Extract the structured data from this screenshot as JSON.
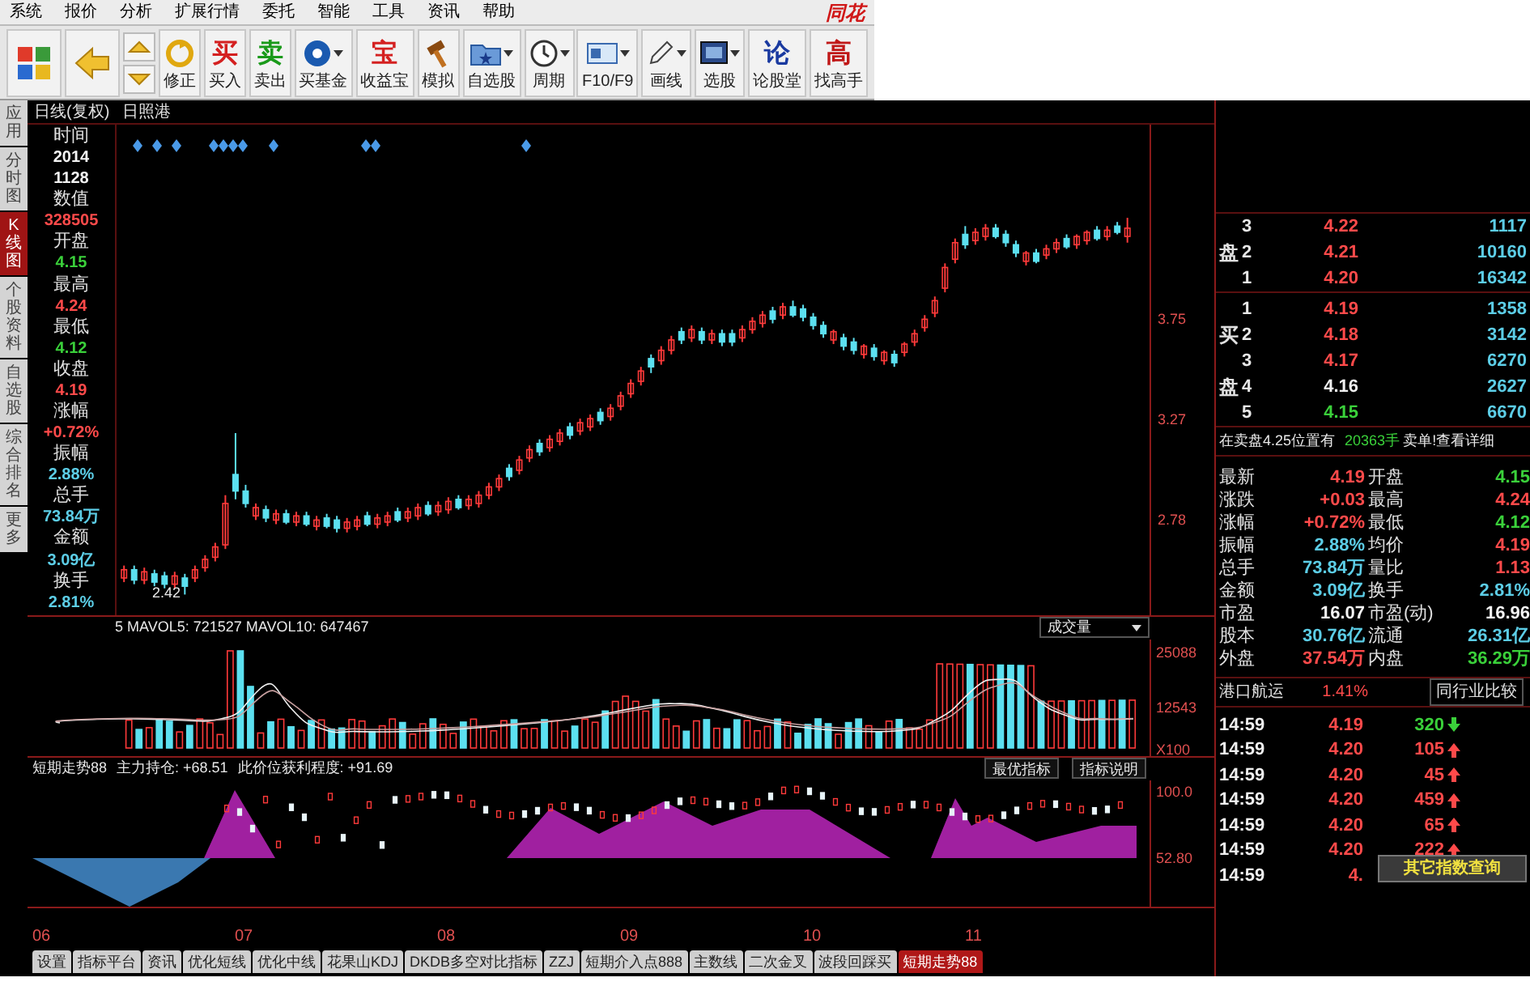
{
  "menu": [
    "系统",
    "报价",
    "分析",
    "扩展行情",
    "委托",
    "智能",
    "工具",
    "资讯",
    "帮助"
  ],
  "logo": "同花",
  "toolbar": [
    {
      "kind": "grid"
    },
    {
      "kind": "back"
    },
    {
      "kind": "updown"
    },
    {
      "kind": "refresh",
      "label": "修正"
    },
    {
      "kind": "glyph",
      "glyph": "买",
      "label": "买入",
      "color": "#d42020"
    },
    {
      "kind": "glyph",
      "glyph": "卖",
      "label": "卖出",
      "color": "#1a9a1a"
    },
    {
      "kind": "disc",
      "label": "买基金",
      "dropdown": true
    },
    {
      "kind": "glyph",
      "glyph": "宝",
      "label": "收益宝",
      "color": "#d42020"
    },
    {
      "kind": "hammer",
      "label": "模拟"
    },
    {
      "kind": "folder",
      "label": "自选股",
      "dropdown": true
    },
    {
      "kind": "clock",
      "label": "周期",
      "dropdown": true
    },
    {
      "kind": "card",
      "label": "F10/F9",
      "dropdown": true
    },
    {
      "kind": "pencil",
      "label": "画线",
      "dropdown": true
    },
    {
      "kind": "screen",
      "label": "选股",
      "dropdown": true
    },
    {
      "kind": "glyph",
      "glyph": "论",
      "label": "论股堂",
      "color": "#1a3aa0"
    },
    {
      "kind": "glyph",
      "glyph": "高",
      "label": "找高手",
      "color": "#c01818"
    }
  ],
  "side_tabs": [
    {
      "label": "应用",
      "selected": false
    },
    {
      "label": "分时图",
      "selected": false
    },
    {
      "label": "K线图",
      "selected": true
    },
    {
      "label": "个股资料",
      "selected": false
    },
    {
      "label": "自选股",
      "selected": false
    },
    {
      "label": "综合排名",
      "selected": false
    },
    {
      "label": "更多",
      "selected": false
    }
  ],
  "chart_title": {
    "period": "日线(复权)",
    "stock": "日照港"
  },
  "info_panel": [
    {
      "text": "时间",
      "kind": "label"
    },
    {
      "text": "2014",
      "kind": "value",
      "color": "#f4f4f4"
    },
    {
      "text": "1128",
      "kind": "value",
      "color": "#f4f4f4"
    },
    {
      "text": "数值",
      "kind": "label"
    },
    {
      "text": "328505",
      "kind": "value",
      "color": "#ff4a4a"
    },
    {
      "text": "开盘",
      "kind": "label"
    },
    {
      "text": "4.15",
      "kind": "value",
      "color": "#3ad03a"
    },
    {
      "text": "最高",
      "kind": "label"
    },
    {
      "text": "4.24",
      "kind": "value",
      "color": "#ff4a4a"
    },
    {
      "text": "最低",
      "kind": "label"
    },
    {
      "text": "4.12",
      "kind": "value",
      "color": "#3ad03a"
    },
    {
      "text": "收盘",
      "kind": "label"
    },
    {
      "text": "4.19",
      "kind": "value",
      "color": "#ff4a4a"
    },
    {
      "text": "涨幅",
      "kind": "label"
    },
    {
      "text": "+0.72%",
      "kind": "value",
      "color": "#ff4a4a"
    },
    {
      "text": "振幅",
      "kind": "label"
    },
    {
      "text": "2.88%",
      "kind": "value",
      "color": "#5ccde6"
    },
    {
      "text": "总手",
      "kind": "label"
    },
    {
      "text": "73.84万",
      "kind": "value",
      "color": "#5ccde6"
    },
    {
      "text": "金额",
      "kind": "label"
    },
    {
      "text": "3.09亿",
      "kind": "value",
      "color": "#5ccde6"
    },
    {
      "text": "换手",
      "kind": "label"
    },
    {
      "text": "2.81%",
      "kind": "value",
      "color": "#5ccde6"
    }
  ],
  "price_chart": {
    "low_label": "2.42",
    "chart_data": {
      "type": "candlestick",
      "ylim": [
        2.32,
        4.69
      ],
      "yticks": [
        3.75,
        3.27,
        2.78
      ],
      "ohlc": [
        [
          2.5,
          2.56,
          2.48,
          2.54
        ],
        [
          2.54,
          2.56,
          2.47,
          2.49
        ],
        [
          2.49,
          2.55,
          2.47,
          2.53
        ],
        [
          2.52,
          2.54,
          2.46,
          2.48
        ],
        [
          2.51,
          2.53,
          2.45,
          2.47
        ],
        [
          2.47,
          2.53,
          2.45,
          2.51
        ],
        [
          2.5,
          2.52,
          2.42,
          2.46
        ],
        [
          2.5,
          2.56,
          2.48,
          2.54
        ],
        [
          2.55,
          2.61,
          2.53,
          2.59
        ],
        [
          2.6,
          2.67,
          2.58,
          2.65
        ],
        [
          2.66,
          2.9,
          2.64,
          2.86
        ],
        [
          3.0,
          3.2,
          2.88,
          2.92
        ],
        [
          2.92,
          2.95,
          2.84,
          2.86
        ],
        [
          2.8,
          2.86,
          2.78,
          2.84
        ],
        [
          2.83,
          2.85,
          2.77,
          2.79
        ],
        [
          2.78,
          2.83,
          2.76,
          2.81
        ],
        [
          2.81,
          2.83,
          2.76,
          2.77
        ],
        [
          2.77,
          2.82,
          2.75,
          2.8
        ],
        [
          2.8,
          2.82,
          2.75,
          2.76
        ],
        [
          2.75,
          2.8,
          2.73,
          2.78
        ],
        [
          2.79,
          2.81,
          2.74,
          2.75
        ],
        [
          2.78,
          2.8,
          2.72,
          2.74
        ],
        [
          2.74,
          2.79,
          2.72,
          2.77
        ],
        [
          2.75,
          2.8,
          2.73,
          2.78
        ],
        [
          2.8,
          2.82,
          2.75,
          2.76
        ],
        [
          2.76,
          2.81,
          2.74,
          2.79
        ],
        [
          2.77,
          2.82,
          2.75,
          2.8
        ],
        [
          2.82,
          2.84,
          2.77,
          2.78
        ],
        [
          2.79,
          2.84,
          2.77,
          2.82
        ],
        [
          2.8,
          2.86,
          2.78,
          2.84
        ],
        [
          2.85,
          2.87,
          2.8,
          2.81
        ],
        [
          2.82,
          2.87,
          2.8,
          2.85
        ],
        [
          2.83,
          2.89,
          2.81,
          2.87
        ],
        [
          2.88,
          2.9,
          2.83,
          2.84
        ],
        [
          2.85,
          2.9,
          2.83,
          2.88
        ],
        [
          2.86,
          2.92,
          2.84,
          2.9
        ],
        [
          2.9,
          2.96,
          2.88,
          2.94
        ],
        [
          2.94,
          3.0,
          2.92,
          2.98
        ],
        [
          3.03,
          3.05,
          2.97,
          2.99
        ],
        [
          3.02,
          3.09,
          3.0,
          3.07
        ],
        [
          3.08,
          3.14,
          3.06,
          3.12
        ],
        [
          3.15,
          3.17,
          3.09,
          3.11
        ],
        [
          3.13,
          3.19,
          3.11,
          3.17
        ],
        [
          3.16,
          3.22,
          3.14,
          3.2
        ],
        [
          3.23,
          3.25,
          3.17,
          3.19
        ],
        [
          3.21,
          3.27,
          3.19,
          3.25
        ],
        [
          3.23,
          3.29,
          3.21,
          3.27
        ],
        [
          3.3,
          3.32,
          3.24,
          3.26
        ],
        [
          3.28,
          3.34,
          3.26,
          3.32
        ],
        [
          3.33,
          3.4,
          3.31,
          3.38
        ],
        [
          3.39,
          3.46,
          3.37,
          3.44
        ],
        [
          3.45,
          3.52,
          3.43,
          3.5
        ],
        [
          3.56,
          3.58,
          3.49,
          3.52
        ],
        [
          3.55,
          3.62,
          3.53,
          3.6
        ],
        [
          3.6,
          3.67,
          3.58,
          3.65
        ],
        [
          3.69,
          3.71,
          3.63,
          3.65
        ],
        [
          3.66,
          3.72,
          3.64,
          3.7
        ],
        [
          3.69,
          3.71,
          3.63,
          3.65
        ],
        [
          3.65,
          3.7,
          3.63,
          3.68
        ],
        [
          3.68,
          3.7,
          3.62,
          3.64
        ],
        [
          3.68,
          3.7,
          3.62,
          3.64
        ],
        [
          3.66,
          3.72,
          3.64,
          3.7
        ],
        [
          3.7,
          3.76,
          3.68,
          3.74
        ],
        [
          3.73,
          3.79,
          3.71,
          3.77
        ],
        [
          3.79,
          3.81,
          3.73,
          3.75
        ],
        [
          3.77,
          3.83,
          3.75,
          3.81
        ],
        [
          3.81,
          3.84,
          3.76,
          3.77
        ],
        [
          3.8,
          3.82,
          3.74,
          3.76
        ],
        [
          3.76,
          3.78,
          3.7,
          3.72
        ],
        [
          3.72,
          3.74,
          3.66,
          3.68
        ],
        [
          3.65,
          3.7,
          3.63,
          3.69
        ],
        [
          3.66,
          3.68,
          3.6,
          3.62
        ],
        [
          3.64,
          3.66,
          3.58,
          3.6
        ],
        [
          3.58,
          3.63,
          3.56,
          3.62
        ],
        [
          3.61,
          3.63,
          3.55,
          3.57
        ],
        [
          3.55,
          3.6,
          3.53,
          3.59
        ],
        [
          3.58,
          3.6,
          3.52,
          3.54
        ],
        [
          3.59,
          3.64,
          3.57,
          3.63
        ],
        [
          3.64,
          3.7,
          3.62,
          3.68
        ],
        [
          3.71,
          3.77,
          3.69,
          3.75
        ],
        [
          3.78,
          3.86,
          3.76,
          3.84
        ],
        [
          3.9,
          4.02,
          3.88,
          4.0
        ],
        [
          4.04,
          4.14,
          4.02,
          4.12
        ],
        [
          4.16,
          4.2,
          4.09,
          4.11
        ],
        [
          4.13,
          4.19,
          4.11,
          4.17
        ],
        [
          4.15,
          4.21,
          4.13,
          4.19
        ],
        [
          4.19,
          4.21,
          4.14,
          4.15
        ],
        [
          4.16,
          4.18,
          4.1,
          4.12
        ],
        [
          4.11,
          4.13,
          4.05,
          4.07
        ],
        [
          4.03,
          4.08,
          4.01,
          4.07
        ],
        [
          4.07,
          4.09,
          4.02,
          4.03
        ],
        [
          4.06,
          4.11,
          4.04,
          4.09
        ],
        [
          4.09,
          4.14,
          4.07,
          4.12
        ],
        [
          4.14,
          4.16,
          4.09,
          4.1
        ],
        [
          4.11,
          4.16,
          4.09,
          4.15
        ],
        [
          4.13,
          4.18,
          4.11,
          4.17
        ],
        [
          4.18,
          4.2,
          4.13,
          4.14
        ],
        [
          4.15,
          4.2,
          4.13,
          4.18
        ],
        [
          4.2,
          4.22,
          4.16,
          4.17
        ],
        [
          4.15,
          4.24,
          4.12,
          4.19
        ]
      ]
    }
  },
  "date_axis": [
    "06",
    "07",
    "08",
    "09",
    "10",
    "11"
  ],
  "volume": {
    "title": "5 MAVOL5: 721527 MAVOL10: 647467",
    "selector": "成交量",
    "axis": [
      "25088",
      "12543",
      "X100"
    ]
  },
  "indicator": {
    "name": "短期走势88",
    "readings": [
      "主力持仓: +68.51",
      "此价位获利程度: +91.69"
    ],
    "buttons": [
      "最优指标",
      "指标说明"
    ],
    "axis": [
      "100.0",
      "52.80"
    ]
  },
  "indicator_tabs": [
    {
      "label": "设置",
      "selected": false
    },
    {
      "label": "指标平台",
      "selected": false
    },
    {
      "label": "资讯",
      "selected": false
    },
    {
      "label": "优化短线",
      "selected": false
    },
    {
      "label": "优化中线",
      "selected": false
    },
    {
      "label": "花果山KDJ",
      "selected": false
    },
    {
      "label": "DKDB多空对比指标",
      "selected": false
    },
    {
      "label": "ZZJ",
      "selected": false
    },
    {
      "label": "短期介入点888",
      "selected": false
    },
    {
      "label": "主数线",
      "selected": false
    },
    {
      "label": "二次金叉",
      "selected": false
    },
    {
      "label": "波段回踩买",
      "selected": false
    },
    {
      "label": "短期走势88",
      "selected": true
    }
  ],
  "order_book": {
    "sell": [
      {
        "rank": "3",
        "price": "4.22",
        "volume": "1117",
        "color": "#ff4a4a"
      },
      {
        "side": "盘",
        "rank": "2",
        "price": "4.21",
        "volume": "10160",
        "color": "#ff4a4a"
      },
      {
        "rank": "1",
        "price": "4.20",
        "volume": "16342",
        "color": "#ff4a4a"
      }
    ],
    "buy": [
      {
        "rank": "1",
        "price": "4.19",
        "volume": "1358",
        "color": "#ff4a4a"
      },
      {
        "side": "买",
        "rank": "2",
        "price": "4.18",
        "volume": "3142",
        "color": "#ff4a4a"
      },
      {
        "rank": "3",
        "price": "4.17",
        "volume": "6270",
        "color": "#ff4a4a"
      },
      {
        "side": "盘",
        "rank": "4",
        "price": "4.16",
        "volume": "2627",
        "color": "#f0f0f0"
      },
      {
        "rank": "5",
        "price": "4.15",
        "volume": "6670",
        "color": "#3ad03a"
      }
    ]
  },
  "alert": {
    "text": "在卖盘4.25位置有",
    "volume": "20363手",
    "action": "卖单!查看详细"
  },
  "quotes": [
    {
      "label": "最新",
      "value": "4.19",
      "color": "#ff4a4a"
    },
    {
      "label": "开盘",
      "value": "4.15",
      "color": "#3ad03a"
    },
    {
      "label": "涨跌",
      "value": "+0.03",
      "color": "#ff4a4a"
    },
    {
      "label": "最高",
      "value": "4.24",
      "color": "#ff4a4a"
    },
    {
      "label": "涨幅",
      "value": "+0.72%",
      "color": "#ff4a4a"
    },
    {
      "label": "最低",
      "value": "4.12",
      "color": "#3ad03a"
    },
    {
      "label": "振幅",
      "value": "2.88%",
      "color": "#5ccde6"
    },
    {
      "label": "均价",
      "value": "4.19",
      "color": "#ff4a4a"
    },
    {
      "label": "总手",
      "value": "73.84万",
      "color": "#5ccde6"
    },
    {
      "label": "量比",
      "value": "1.13",
      "color": "#ff4a4a"
    },
    {
      "label": "金额",
      "value": "3.09亿",
      "color": "#5ccde6"
    },
    {
      "label": "换手",
      "value": "2.81%",
      "color": "#5ccde6"
    },
    {
      "label": "市盈",
      "value": "16.07",
      "color": "#f4f4f4"
    },
    {
      "label": "市盈(动)",
      "value": "16.96",
      "color": "#f4f4f4"
    },
    {
      "label": "股本",
      "value": "30.76亿",
      "color": "#5ccde6"
    },
    {
      "label": "流通",
      "value": "26.31亿",
      "color": "#5ccde6"
    },
    {
      "label": "外盘",
      "value": "37.54万",
      "color": "#ff4a4a"
    },
    {
      "label": "内盘",
      "value": "36.29万",
      "color": "#3ad03a"
    }
  ],
  "industry": {
    "name": "港口航运",
    "change": "1.41%",
    "link": "同行业比较"
  },
  "trades": [
    {
      "time": "14:59",
      "price": "4.19",
      "volume": "320",
      "rising": false
    },
    {
      "time": "14:59",
      "price": "4.20",
      "volume": "105",
      "rising": true
    },
    {
      "time": "14:59",
      "price": "4.20",
      "volume": "45",
      "rising": true
    },
    {
      "time": "14:59",
      "price": "4.20",
      "volume": "459",
      "rising": true
    },
    {
      "time": "14:59",
      "price": "4.20",
      "volume": "65",
      "rising": true
    },
    {
      "time": "14:59",
      "price": "4.20",
      "volume": "222",
      "rising": true
    },
    {
      "time": "14:59",
      "price": "4."
    }
  ],
  "popup": "其它指数查询"
}
